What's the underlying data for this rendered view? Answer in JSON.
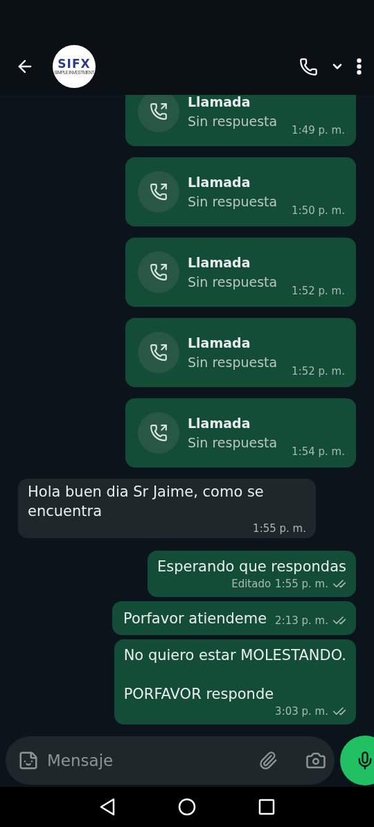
{
  "header": {
    "avatar_logo": {
      "brand": "SIFX",
      "tagline": "SIMPLE INVESTMENT"
    }
  },
  "messages": [
    {
      "kind": "call",
      "outgoing": true,
      "title": "Llamada",
      "subtitle": "Sin respuesta",
      "time": "1:49 p. m."
    },
    {
      "kind": "call",
      "outgoing": true,
      "title": "Llamada",
      "subtitle": "Sin respuesta",
      "time": "1:50 p. m."
    },
    {
      "kind": "call",
      "outgoing": true,
      "title": "Llamada",
      "subtitle": "Sin respuesta",
      "time": "1:52 p. m."
    },
    {
      "kind": "call",
      "outgoing": true,
      "title": "Llamada",
      "subtitle": "Sin respuesta",
      "time": "1:52 p. m."
    },
    {
      "kind": "call",
      "outgoing": true,
      "title": "Llamada",
      "subtitle": "Sin respuesta",
      "time": "1:54 p. m."
    },
    {
      "kind": "text",
      "outgoing": false,
      "text": "Hola buen dia Sr Jaime, como se encuentra",
      "time": "1:55 p. m."
    },
    {
      "kind": "text",
      "outgoing": true,
      "text": "Esperando que respondas",
      "edited_label": "Editado",
      "time": "1:55 p. m.",
      "delivered": true
    },
    {
      "kind": "text",
      "outgoing": true,
      "text": "Porfavor atiendeme",
      "time": "2:13 p. m.",
      "delivered": true,
      "inline_time": true
    },
    {
      "kind": "text",
      "outgoing": true,
      "text": "No quiero estar MOLESTANDO.\n\nPORFAVOR responde",
      "time": "3:03 p. m.",
      "delivered": true
    }
  ],
  "composer": {
    "placeholder": "Mensaje"
  }
}
